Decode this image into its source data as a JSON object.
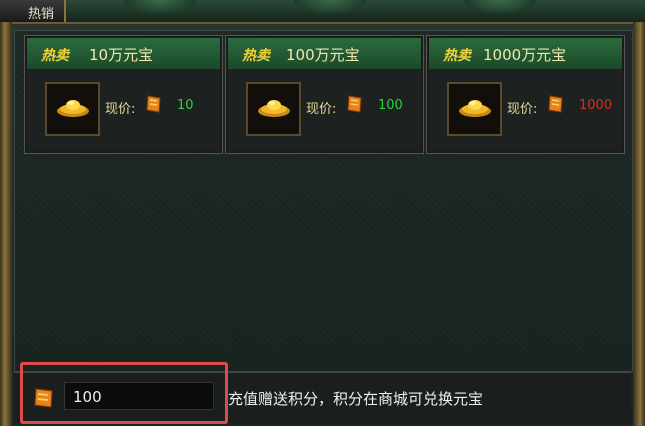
{
  "window": {
    "title": "热销"
  },
  "cards": [
    {
      "hot_label": "热卖",
      "amount": "10万元宝",
      "price_label": "现价:",
      "price": "10",
      "price_color": "#29d33a"
    },
    {
      "hot_label": "热卖",
      "amount": "100万元宝",
      "price_label": "现价:",
      "price": "100",
      "price_color": "#29d33a"
    },
    {
      "hot_label": "热卖",
      "amount": "1000万元宝",
      "price_label": "现价:",
      "price": "1000",
      "price_color": "#e02a1e"
    }
  ],
  "footer": {
    "points_value": "100",
    "hint": "充值赠送积分，积分在商城可兑换元宝"
  },
  "icons": {
    "item": "gold-ingot-icon",
    "currency": "coupon-icon"
  },
  "colors": {
    "header_green": "#2d6b3e",
    "gold_text": "#f2d23a",
    "highlight": "#e04a4a"
  }
}
